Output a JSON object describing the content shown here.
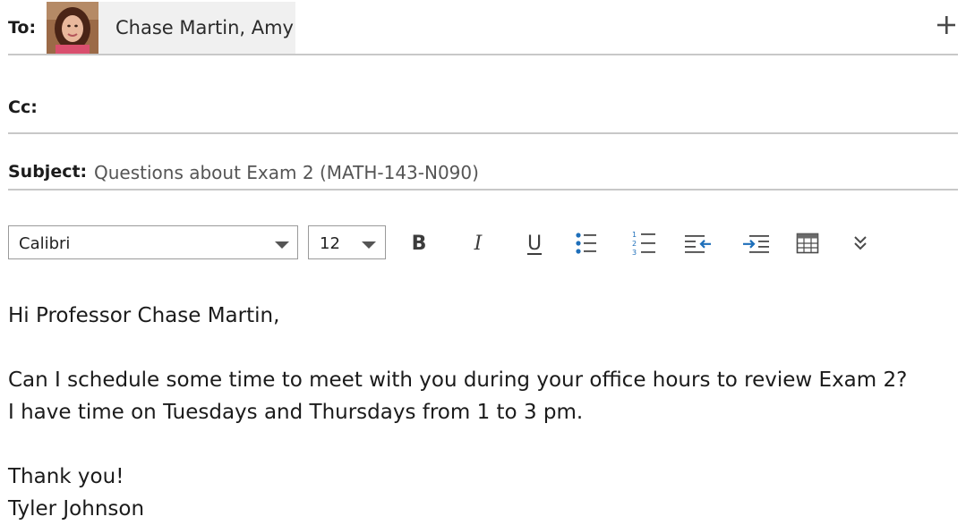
{
  "to": {
    "label": "To:",
    "recipient": "Chase Martin, Amy",
    "add_icon": "plus-icon"
  },
  "cc": {
    "label": "Cc:"
  },
  "subject": {
    "label": "Subject:",
    "value": "Questions about Exam 2 (MATH-143-N090)"
  },
  "toolbar": {
    "font": "Calibri",
    "size": "12",
    "buttons": [
      "bold-icon",
      "italic-icon",
      "underline-icon",
      "bullet-list-icon",
      "numbered-list-icon",
      "decrease-indent-icon",
      "increase-indent-icon",
      "table-icon",
      "more-options-icon"
    ],
    "bold_glyph": "B",
    "italic_glyph": "I",
    "underline_glyph": "U"
  },
  "body": {
    "greeting": "Hi Professor Chase Martin,",
    "line1": "Can I schedule some time to meet with you during your office hours to review Exam 2?",
    "line2": "I have time on Tuesdays and Thursdays from 1 to 3 pm.",
    "closing": "Thank you!",
    "signature": "Tyler Johnson"
  },
  "colors": {
    "accent": "#1e6fba",
    "divider": "#c8c8c8",
    "chip": "#f0f0f0"
  }
}
